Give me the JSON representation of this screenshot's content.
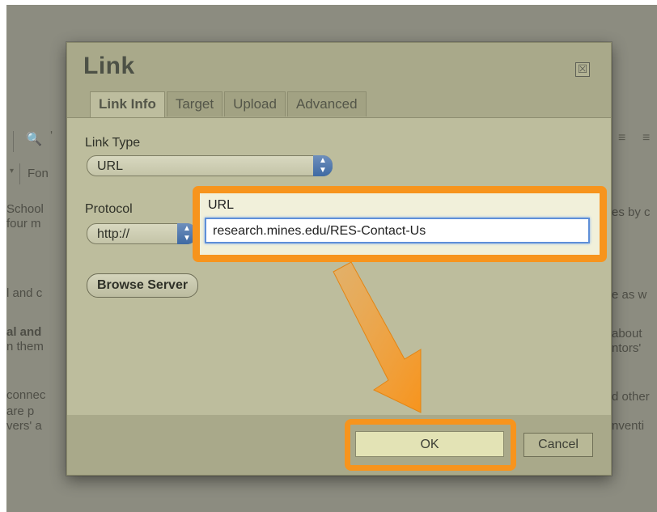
{
  "dialog": {
    "title": "Link",
    "close_symbol": "☒",
    "tabs": [
      "Link Info",
      "Target",
      "Upload",
      "Advanced"
    ],
    "link_type_label": "Link Type",
    "link_type_value": "URL",
    "protocol_label": "Protocol",
    "protocol_value": "http://",
    "url_label": "URL",
    "url_value": "research.mines.edu/RES-Contact-Us",
    "browse_label": "Browse Server",
    "ok_label": "OK",
    "cancel_label": "Cancel"
  },
  "background": {
    "font_label": "Fon",
    "lines_left": [
      "School",
      "four m",
      "l and c",
      "al and",
      "n them",
      "connec",
      "are p",
      "vers' a"
    ],
    "lines_right": [
      "es by c",
      "e as w",
      "about",
      "ntors'",
      "d other",
      "nventi"
    ]
  },
  "icons": {
    "binoculars": "binoculars-icon",
    "align": "align-icon"
  },
  "colors": {
    "highlight": "#f7941d",
    "dialog_bg": "#a9a98a",
    "panel_bg": "#bdbd9d"
  }
}
